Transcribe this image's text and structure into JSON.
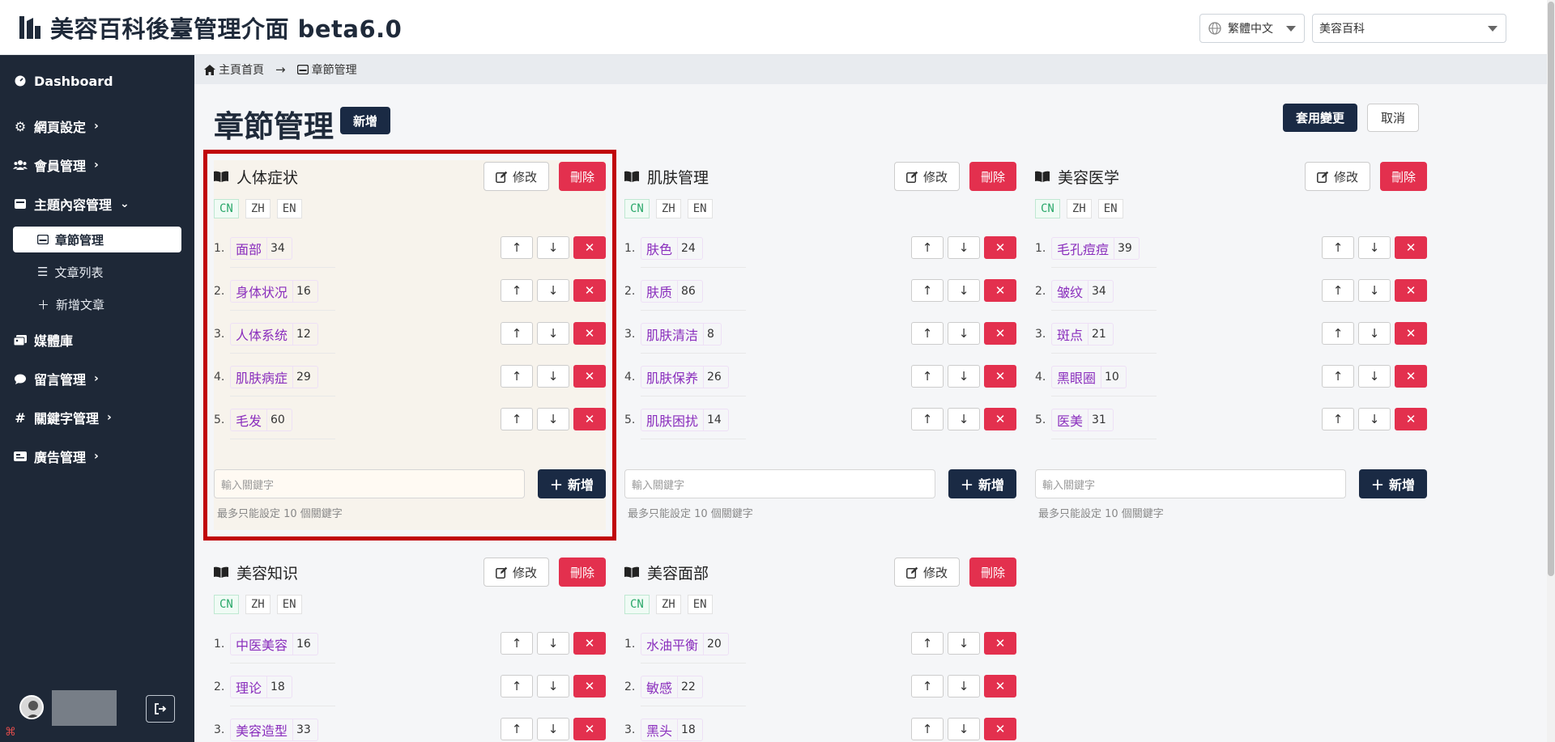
{
  "app": {
    "title": "美容百科後臺管理介面 beta6.0",
    "language_select": "繁體中文",
    "site_select": "美容百科"
  },
  "sidebar": {
    "items": [
      {
        "label": "Dashboard",
        "icon": "dashboard-icon"
      },
      {
        "label": "網頁設定",
        "icon": "gear-icon"
      },
      {
        "label": "會員管理",
        "icon": "users-icon"
      },
      {
        "label": "主題內容管理",
        "icon": "content-icon"
      },
      {
        "label": "媒體庫",
        "icon": "images-icon"
      },
      {
        "label": "留言管理",
        "icon": "comment-icon"
      },
      {
        "label": "關鍵字管理",
        "icon": "hash-icon"
      },
      {
        "label": "廣告管理",
        "icon": "ad-icon"
      }
    ],
    "sub_items": [
      {
        "label": "章節管理",
        "icon": "section-icon"
      },
      {
        "label": "文章列表",
        "icon": "list-icon"
      },
      {
        "label": "新增文章",
        "icon": "plus-icon"
      }
    ]
  },
  "breadcrumb": {
    "home": "主頁首頁",
    "current": "章節管理"
  },
  "page": {
    "title": "章節管理",
    "add_label": "新增",
    "apply_label": "套用變更",
    "cancel_label": "取消"
  },
  "card_labels": {
    "edit": "修改",
    "delete": "刪除",
    "input_placeholder": "輸入關鍵字",
    "add": "新增",
    "hint": "最多只能設定 10 個關鍵字",
    "langs": [
      "CN",
      "ZH",
      "EN"
    ]
  },
  "sections": [
    {
      "title": "人体症状",
      "keywords": [
        {
          "num": "1.",
          "name": "面部",
          "count": "34"
        },
        {
          "num": "2.",
          "name": "身体状况",
          "count": "16"
        },
        {
          "num": "3.",
          "name": "人体系统",
          "count": "12"
        },
        {
          "num": "4.",
          "name": "肌肤病症",
          "count": "29"
        },
        {
          "num": "5.",
          "name": "毛发",
          "count": "60"
        }
      ]
    },
    {
      "title": "肌肤管理",
      "keywords": [
        {
          "num": "1.",
          "name": "肤色",
          "count": "24"
        },
        {
          "num": "2.",
          "name": "肤质",
          "count": "86"
        },
        {
          "num": "3.",
          "name": "肌肤清洁",
          "count": "8"
        },
        {
          "num": "4.",
          "name": "肌肤保养",
          "count": "26"
        },
        {
          "num": "5.",
          "name": "肌肤困扰",
          "count": "14"
        }
      ]
    },
    {
      "title": "美容医学",
      "keywords": [
        {
          "num": "1.",
          "name": "毛孔痘痘",
          "count": "39"
        },
        {
          "num": "2.",
          "name": "皱纹",
          "count": "34"
        },
        {
          "num": "3.",
          "name": "斑点",
          "count": "21"
        },
        {
          "num": "4.",
          "name": "黑眼圈",
          "count": "10"
        },
        {
          "num": "5.",
          "name": "医美",
          "count": "31"
        }
      ]
    },
    {
      "title": "美容知识",
      "keywords": [
        {
          "num": "1.",
          "name": "中医美容",
          "count": "16"
        },
        {
          "num": "2.",
          "name": "理论",
          "count": "18"
        },
        {
          "num": "3.",
          "name": "美容造型",
          "count": "33"
        }
      ]
    },
    {
      "title": "美容面部",
      "keywords": [
        {
          "num": "1.",
          "name": "水油平衡",
          "count": "20"
        },
        {
          "num": "2.",
          "name": "敏感",
          "count": "22"
        },
        {
          "num": "3.",
          "name": "黑头",
          "count": "18"
        }
      ]
    }
  ],
  "colors": {
    "sidebar_bg": "#1e2837",
    "primary_dark": "#1a2a44",
    "danger": "#e3304e",
    "keyword_text": "#8a2ebd",
    "highlight_border": "#c0040a"
  }
}
